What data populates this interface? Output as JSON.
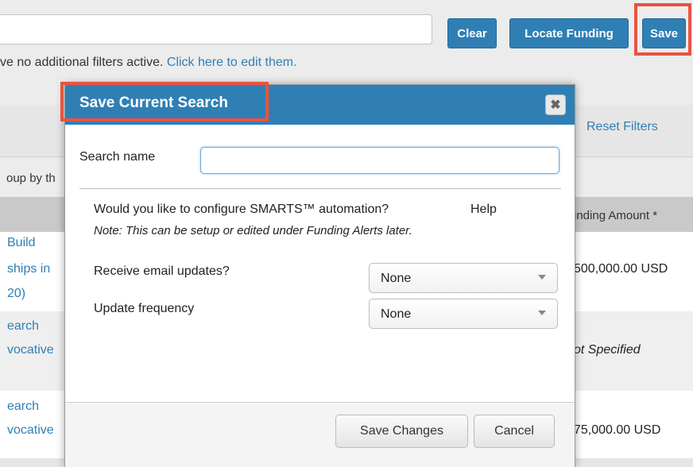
{
  "toolbar": {
    "clear_label": "Clear",
    "locate_label": "Locate Funding",
    "save_label": "Save"
  },
  "filters": {
    "text": "ve no additional filters active. ",
    "link": "Click here to edit them.",
    "reset_label": "Reset Filters"
  },
  "table": {
    "group_by_text": "oup by th",
    "amount_header": "inding Amount *",
    "rows": [
      {
        "title_lines": [
          "Build",
          "ships in",
          "20)"
        ],
        "amount": "500,000.00 USD"
      },
      {
        "title_lines": [
          "earch",
          "vocative"
        ],
        "amount": "ot Specified"
      },
      {
        "title_lines": [
          "earch",
          "vocative"
        ],
        "amount": "75,000.00 USD"
      }
    ]
  },
  "modal": {
    "title": "Save Current Search",
    "close_symbol": "✖",
    "search_name_label": "Search name",
    "search_name_value": "",
    "automation_question": "Would you like to configure SMARTS™ automation?",
    "help_label": "Help",
    "note": "Note: This can be setup or edited under Funding Alerts later.",
    "email_label": "Receive email updates?",
    "email_value": "None",
    "frequency_label": "Update frequency",
    "frequency_value": "None",
    "save_changes_label": "Save Changes",
    "cancel_label": "Cancel"
  },
  "colors": {
    "primary": "#2f7fb5",
    "highlight": "#e8543e"
  }
}
